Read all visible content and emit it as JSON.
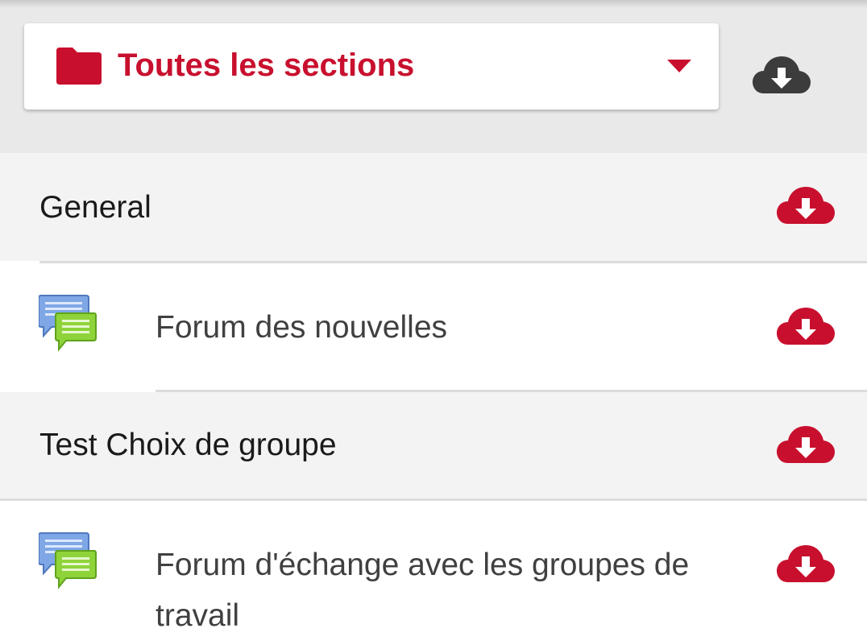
{
  "header": {
    "section_select": {
      "label": "Toutes les sections",
      "icon": "folder-icon",
      "dropdown_icon": "caret-down-icon"
    },
    "download_all_icon": "cloud-download-icon"
  },
  "rows": [
    {
      "type": "section",
      "label": "General",
      "action_icon": "cloud-download-icon"
    },
    {
      "type": "module",
      "label": "Forum des nouvelles",
      "icon": "forum-icon",
      "action_icon": "cloud-download-icon"
    },
    {
      "type": "section",
      "label": "Test Choix de groupe",
      "action_icon": "cloud-download-icon"
    },
    {
      "type": "module",
      "label_line1": "Forum d'échange avec les groupes de",
      "label_line2": "travail",
      "icon": "forum-icon",
      "action_icon": "cloud-download-icon"
    }
  ],
  "colors": {
    "accent": "#c8102e",
    "dark_icon": "#3c3c3c",
    "section_background": "#f3f3f3",
    "header_background": "#e9e9e9"
  }
}
